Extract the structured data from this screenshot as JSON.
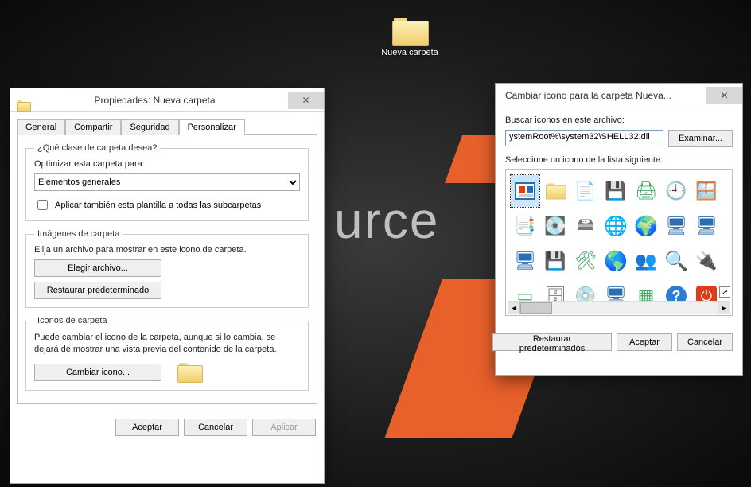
{
  "desktop": {
    "bg_text": "urce",
    "folder_label": "Nueva carpeta"
  },
  "properties": {
    "title": "Propiedades: Nueva carpeta",
    "tabs": [
      "General",
      "Compartir",
      "Seguridad",
      "Personalizar"
    ],
    "active_tab": "Personalizar",
    "group_type": {
      "legend": "¿Qué clase de carpeta desea?",
      "optimize_label": "Optimizar esta carpeta para:",
      "optimize_value": "Elementos generales",
      "apply_subfolders": "Aplicar también esta plantilla a todas las subcarpetas"
    },
    "group_images": {
      "legend": "Imágenes de carpeta",
      "desc": "Elija un archivo para mostrar en este icono de carpeta.",
      "choose_btn": "Elegir archivo...",
      "restore_btn": "Restaurar predeterminado"
    },
    "group_icons": {
      "legend": "Iconos de carpeta",
      "desc": "Puede cambiar el icono de la carpeta, aunque si lo cambia, se dejará de mostrar una vista previa del contenido de la carpeta.",
      "change_btn": "Cambiar icono..."
    },
    "footer": {
      "ok": "Aceptar",
      "cancel": "Cancelar",
      "apply": "Aplicar"
    }
  },
  "changeicon": {
    "title": "Cambiar icono para la carpeta Nueva...",
    "search_label": "Buscar iconos en este archivo:",
    "path_value": "ystemRoot%\\system32\\SHELL32.dll",
    "browse_btn": "Examinar...",
    "select_label": "Seleccione un icono de la lista siguiente:",
    "restore_btn": "Restaurar predeterminados",
    "ok": "Aceptar",
    "cancel": "Cancelar",
    "icons": [
      "document-icon",
      "folder-icon",
      "page-icon",
      "chip-icon",
      "printer-icon",
      "clock-icon",
      "window-icon",
      "sheet-icon",
      "disk-icon",
      "drive-icon",
      "globe-icon",
      "network-icon",
      "display-icon",
      "screen-icon",
      "screen2-icon",
      "floppy-icon",
      "regedit-icon",
      "world-icon",
      "people-icon",
      "search-icon",
      "usb-icon",
      "blank-icon",
      "tray-icon",
      "cd-icon",
      "mycomputer-icon",
      "grid-icon",
      "help-icon",
      "power-icon"
    ]
  },
  "icon_glyphs": {
    "document-icon": "🗔",
    "folder-icon": "📁",
    "page-icon": "📄",
    "chip-icon": "💾",
    "printer-icon": "🖨",
    "clock-icon": "🕘",
    "window-icon": "🪟",
    "sheet-icon": "📑",
    "disk-icon": "💽",
    "drive-icon": "🖴",
    "globe-icon": "🌐",
    "network-icon": "🌍",
    "display-icon": "🖥",
    "screen-icon": "🖥",
    "screen2-icon": "🖥",
    "floppy-icon": "💾",
    "regedit-icon": "🛠",
    "world-icon": "🌎",
    "people-icon": "👥",
    "search-icon": "🔍",
    "usb-icon": "🔌",
    "blank-icon": "▭",
    "tray-icon": "🗄",
    "cd-icon": "💿",
    "mycomputer-icon": "🖥",
    "grid-icon": "▦",
    "help-icon": "❔",
    "power-icon": "⏻"
  }
}
